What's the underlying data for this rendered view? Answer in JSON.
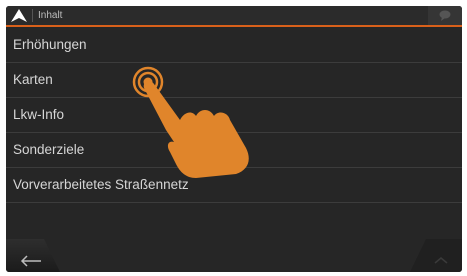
{
  "header": {
    "title": "Inhalt"
  },
  "menu": {
    "items": [
      {
        "label": "Erhöhungen"
      },
      {
        "label": "Karten"
      },
      {
        "label": "Lkw-Info"
      },
      {
        "label": "Sonderziele"
      },
      {
        "label": "Vorverarbeitetes Straßennetz"
      }
    ]
  },
  "colors": {
    "accent": "#d9601a",
    "background": "#262626",
    "hand": "#e0852b"
  },
  "icons": {
    "nav": "navigation-arrow-icon",
    "bubble": "speech-bubble-icon",
    "back": "back-arrow-icon",
    "up": "up-chevron-icon",
    "hand": "tap-gesture-hand-icon"
  }
}
